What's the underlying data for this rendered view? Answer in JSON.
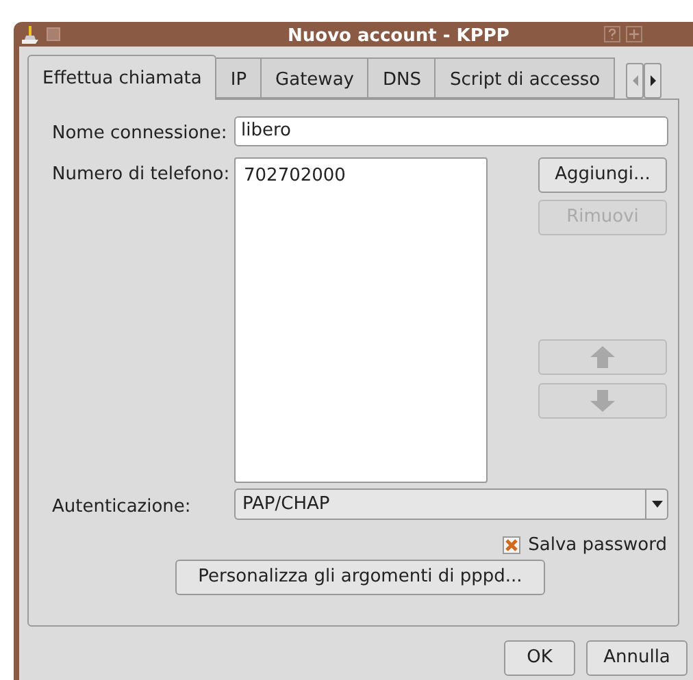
{
  "window": {
    "title": "Nuovo account - KPPP"
  },
  "tabs": [
    {
      "label": "Effettua chiamata",
      "selected": true
    },
    {
      "label": "IP",
      "selected": false
    },
    {
      "label": "Gateway",
      "selected": false
    },
    {
      "label": "DNS",
      "selected": false
    },
    {
      "label": "Script di accesso",
      "selected": false
    }
  ],
  "connection_name": {
    "label": "Nome connessione:",
    "value": "libero"
  },
  "phone_numbers": {
    "label": "Numero di telefono:",
    "items": [
      "702702000"
    ]
  },
  "phone_buttons": [
    {
      "kind": "text",
      "label": "Aggiungi...",
      "disabled": false
    },
    {
      "kind": "text",
      "label": "Rimuovi",
      "disabled": true
    },
    {
      "kind": "up",
      "disabled": true
    },
    {
      "kind": "down",
      "disabled": true
    }
  ],
  "authentication": {
    "label": "Autenticazione:",
    "value": "PAP/CHAP"
  },
  "save_password": {
    "label": "Salva password",
    "checked": true
  },
  "pppd_button": {
    "label": "Personalizza gli argomenti di pppd..."
  },
  "buttons": [
    "OK",
    "Annulla"
  ]
}
